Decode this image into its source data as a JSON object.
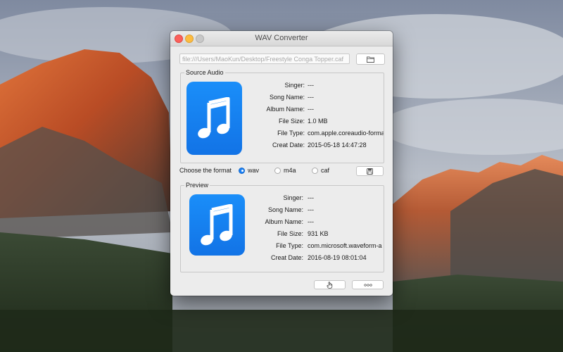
{
  "window": {
    "title": "WAV Converter"
  },
  "path_field": {
    "value": "file:///Users/MaoKun/Desktop/Freestyle Conga Topper.caf"
  },
  "icons": {
    "folder": "folder-icon",
    "save": "save-icon",
    "convert": "hand-pointer-icon",
    "more": "more-icon",
    "music": "music-note-icon"
  },
  "source": {
    "title": "Source Audio",
    "fields": [
      {
        "label": "Singer:",
        "value": "---"
      },
      {
        "label": "Song Name:",
        "value": "---"
      },
      {
        "label": "Album Name:",
        "value": "---"
      },
      {
        "label": "File Size:",
        "value": "1.0 MB"
      },
      {
        "label": "File Type:",
        "value": "com.apple.coreaudio-format"
      },
      {
        "label": "Creat Date:",
        "value": "2015-05-18 14:47:28"
      }
    ]
  },
  "format": {
    "label": "Choose the format",
    "options": [
      {
        "label": "wav",
        "selected": true
      },
      {
        "label": "m4a",
        "selected": false
      },
      {
        "label": "caf",
        "selected": false
      }
    ]
  },
  "preview": {
    "title": "Preview",
    "fields": [
      {
        "label": "Singer:",
        "value": "---"
      },
      {
        "label": "Song Name:",
        "value": "---"
      },
      {
        "label": "Album Name:",
        "value": "---"
      },
      {
        "label": "File Size:",
        "value": "931 KB"
      },
      {
        "label": "File Type:",
        "value": "com.microsoft.waveform-audio"
      },
      {
        "label": "Creat Date:",
        "value": "2016-08-19 08:01:04"
      }
    ]
  },
  "colors": {
    "accent": "#1b80f4",
    "close": "#fc605b",
    "minimize": "#fdbc40"
  }
}
